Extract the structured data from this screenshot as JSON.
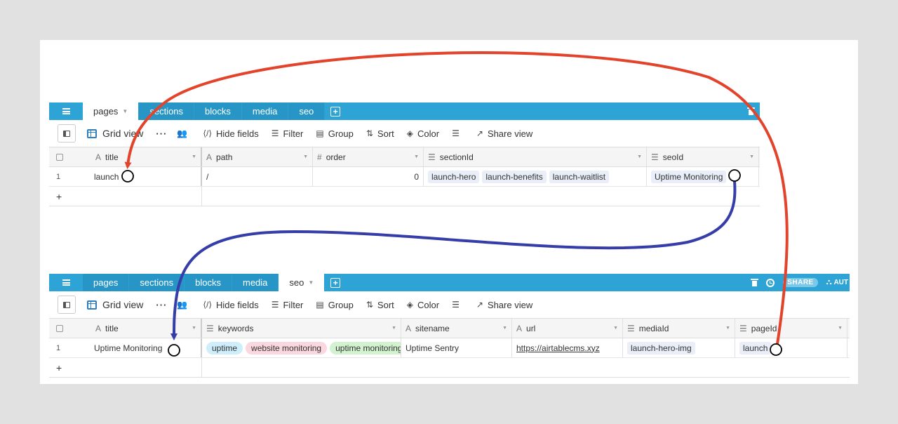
{
  "colors": {
    "tabbar": "#2ea3d6",
    "link_arrow_red": "#e2432a",
    "link_arrow_blue": "#353da8"
  },
  "top_base": {
    "tabs": [
      {
        "label": "pages",
        "active": true
      },
      {
        "label": "sections",
        "active": false
      },
      {
        "label": "blocks",
        "active": false
      },
      {
        "label": "media",
        "active": false
      },
      {
        "label": "seo",
        "active": false
      }
    ],
    "view_name": "Grid view",
    "toolbar": {
      "hide_fields": "Hide fields",
      "filter": "Filter",
      "group": "Group",
      "sort": "Sort",
      "color": "Color",
      "share_view": "Share view"
    },
    "columns": [
      {
        "icon": "A",
        "name": "title"
      },
      {
        "icon": "A",
        "name": "path"
      },
      {
        "icon": "#",
        "name": "order"
      },
      {
        "icon": "☰",
        "name": "sectionId"
      },
      {
        "icon": "☰",
        "name": "seoId"
      }
    ],
    "rows": [
      {
        "num": "1",
        "title": "launch",
        "path": "/",
        "order": "0",
        "sectionId": [
          "launch-hero",
          "launch-benefits",
          "launch-waitlist"
        ],
        "seoId": [
          "Uptime Monitoring"
        ]
      }
    ],
    "add_row": "+"
  },
  "bottom_base": {
    "tabs": [
      {
        "label": "pages",
        "active": false
      },
      {
        "label": "sections",
        "active": false
      },
      {
        "label": "blocks",
        "active": false
      },
      {
        "label": "media",
        "active": false
      },
      {
        "label": "seo",
        "active": true
      }
    ],
    "share_badge": "SHARE",
    "automations_label": "AUT",
    "view_name": "Grid view",
    "toolbar": {
      "hide_fields": "Hide fields",
      "filter": "Filter",
      "group": "Group",
      "sort": "Sort",
      "color": "Color",
      "share_view": "Share view"
    },
    "columns": [
      {
        "icon": "A",
        "name": "title"
      },
      {
        "icon": "☰",
        "name": "keywords"
      },
      {
        "icon": "A",
        "name": "sitename"
      },
      {
        "icon": "A",
        "name": "url"
      },
      {
        "icon": "☰",
        "name": "mediaId"
      },
      {
        "icon": "☰",
        "name": "pageId"
      }
    ],
    "rows": [
      {
        "num": "1",
        "title": "Uptime Monitoring",
        "keywords": [
          {
            "label": "uptime",
            "bg": "#cfeefb"
          },
          {
            "label": "website monitoring",
            "bg": "#fbd7df"
          },
          {
            "label": "uptime monitoring",
            "bg": "#d3f2cf"
          }
        ],
        "sitename": "Uptime Sentry",
        "url": "https://airtablecms.xyz",
        "mediaId": [
          "launch-hero-img"
        ],
        "pageId": [
          "launch"
        ]
      }
    ],
    "add_row": "+"
  }
}
